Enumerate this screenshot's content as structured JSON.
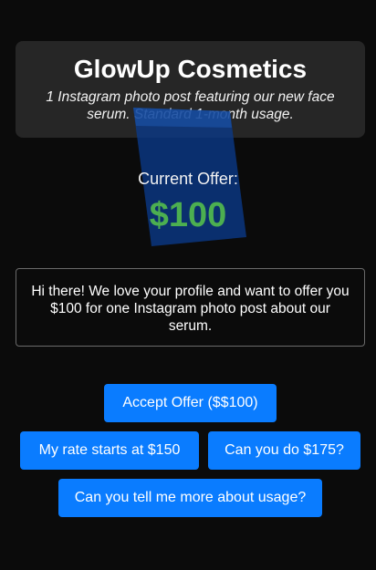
{
  "brand": {
    "name": "GlowUp Cosmetics",
    "campaign_description": "1 Instagram photo post featuring our new face serum. Standard 1-month usage."
  },
  "offer": {
    "label": "Current Offer:",
    "amount": "$100"
  },
  "message": "Hi there! We love your profile and want to offer you $100 for one Instagram photo post about our serum.",
  "actions": {
    "accept_label": "Accept Offer ($$100)",
    "rate_label": "My rate starts at $150",
    "counter_label": "Can you do $175?",
    "usage_label": "Can you tell me more about usage?"
  },
  "colors": {
    "background": "#0b0b0b",
    "card": "#262626",
    "accent_button": "#0a7cff",
    "offer_amount": "#4caf50",
    "cube": "#0a3a8a"
  }
}
